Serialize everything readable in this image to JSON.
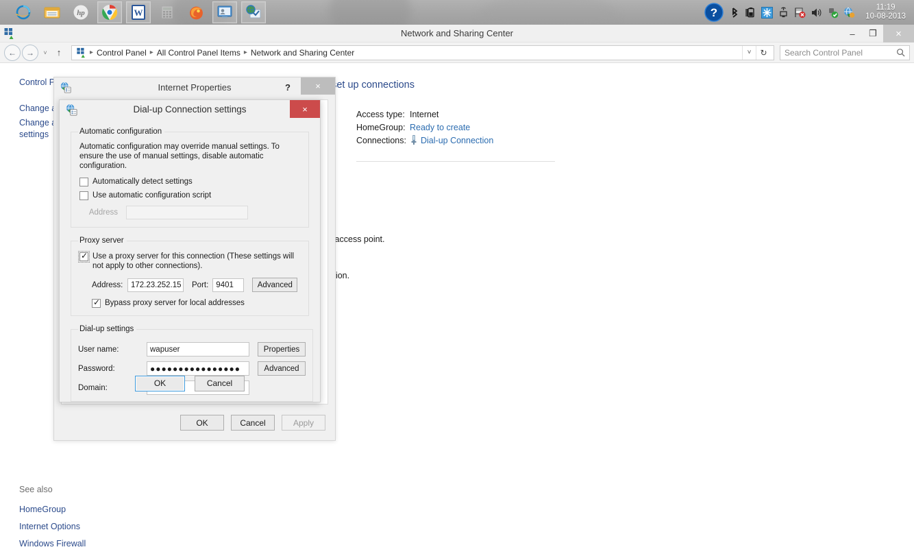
{
  "taskbar": {
    "pinned_apps": [
      {
        "name": "internet-explorer",
        "label": "Internet Explorer",
        "framed": false
      },
      {
        "name": "file-explorer",
        "label": "File Explorer",
        "framed": false
      },
      {
        "name": "hp-support",
        "label": "HP",
        "framed": false
      },
      {
        "name": "google-chrome",
        "label": "Google Chrome",
        "framed": true
      },
      {
        "name": "microsoft-word",
        "label": "Microsoft Word",
        "framed": true
      },
      {
        "name": "calculator",
        "label": "Calculator",
        "framed": false
      },
      {
        "name": "mozilla-firefox",
        "label": "Mozilla Firefox",
        "framed": false
      },
      {
        "name": "remote-desktop",
        "label": "Remote Desktop",
        "framed": true
      },
      {
        "name": "network-sharing-center",
        "label": "Network and Sharing Center",
        "framed": true
      }
    ],
    "tray_icons": [
      {
        "name": "action-center-help-icon",
        "label": "Help"
      },
      {
        "name": "bluetooth-icon",
        "label": "Bluetooth"
      },
      {
        "name": "battery-icon",
        "label": "Battery"
      },
      {
        "name": "snowflake-icon",
        "label": "Intel Graphics"
      },
      {
        "name": "network-connection-icon",
        "label": "Network"
      },
      {
        "name": "flag-error-icon",
        "label": "Action Center"
      },
      {
        "name": "volume-icon",
        "label": "Volume"
      },
      {
        "name": "safely-remove-hardware-icon",
        "label": "Safely Remove Hardware"
      },
      {
        "name": "network-globe-icon",
        "label": "Network Globe"
      }
    ],
    "clock_time": "11:19",
    "clock_date": "10-08-2013"
  },
  "explorer": {
    "title": "Network and Sharing Center",
    "window_buttons": {
      "minimize": "–",
      "maximize": "❐",
      "close": "×"
    },
    "nav": {
      "back": "←",
      "forward": "→",
      "recent": "˅",
      "up": "↑",
      "breadcrumb": [
        "Control Panel",
        "All Control Panel Items",
        "Network and Sharing Center"
      ],
      "breadcrumb_sep": "▸",
      "dropdown": "˅",
      "refresh": "↻"
    },
    "search": {
      "placeholder": "Search Control Panel",
      "icon": "search-icon"
    },
    "sidebar": {
      "items": [
        {
          "label": "Control P...",
          "name": "sidebar-control-panel-home"
        },
        {
          "label": "Change a...",
          "name": "sidebar-change-adapter-settings"
        },
        {
          "label": "Change a... settings",
          "name": "sidebar-change-advanced-sharing-settings"
        }
      ],
      "see_also_heading": "See also",
      "see_also": [
        {
          "label": "HomeGroup",
          "name": "see-also-homegroup"
        },
        {
          "label": "Internet Options",
          "name": "see-also-internet-options"
        },
        {
          "label": "Windows Firewall",
          "name": "see-also-windows-firewall"
        }
      ]
    },
    "main": {
      "heading": "View your basic network information and set up connections",
      "network_info": [
        {
          "label": "Access type:",
          "value": "Internet",
          "link": false
        },
        {
          "label": "HomeGroup:",
          "value": "Ready to create",
          "link": true
        },
        {
          "label": "Connections:",
          "value": "Dial-up Connection",
          "link": true,
          "icon": "dialup-connection-icon"
        }
      ],
      "partial_text_1": "ection; or set up a router or access point.",
      "partial_text_2": "get troubleshooting information."
    }
  },
  "internet_properties": {
    "title": "Internet Properties",
    "help_button": "?",
    "close_button": "×",
    "buttons": [
      {
        "label": "OK",
        "name": "ie-ok-button",
        "disabled": false
      },
      {
        "label": "Cancel",
        "name": "ie-cancel-button",
        "disabled": false
      },
      {
        "label": "Apply",
        "name": "ie-apply-button",
        "disabled": true
      }
    ]
  },
  "dialup_dialog": {
    "title": "Dial-up Connection settings",
    "close_button": "×",
    "auto_config": {
      "legend": "Automatic configuration",
      "description": "Automatic configuration may override manual settings.  To ensure the use of manual settings, disable automatic configuration.",
      "auto_detect": {
        "label": "Automatically detect settings",
        "checked": false
      },
      "use_script": {
        "label": "Use automatic configuration script",
        "checked": false
      },
      "address_label": "Address",
      "address_value": "",
      "address_enabled": false
    },
    "proxy": {
      "legend": "Proxy server",
      "use_proxy": {
        "label": "Use a proxy server for this connection (These settings will not apply to other connections).",
        "checked": true
      },
      "address_label": "Address:",
      "address_value": "172.23.252.15",
      "port_label": "Port:",
      "port_value": "9401",
      "advanced_label": "Advanced",
      "bypass": {
        "label": "Bypass proxy server for local addresses",
        "checked": true
      }
    },
    "dialup_settings": {
      "legend": "Dial-up settings",
      "username_label": "User name:",
      "username_value": "wapuser",
      "properties_label": "Properties",
      "password_label": "Password:",
      "password_value": "●●●●●●●●●●●●●●●●",
      "advanced_label": "Advanced",
      "domain_label": "Domain:",
      "domain_value": ""
    },
    "buttons": [
      {
        "label": "OK",
        "name": "dialup-ok-button",
        "focused": true
      },
      {
        "label": "Cancel",
        "name": "dialup-cancel-button",
        "focused": false
      }
    ]
  },
  "colors": {
    "link": "#2b4a8b",
    "accent_blue": "#2b6cb0",
    "close_red": "#cc4b4b",
    "taskbar": "#a9a9a9"
  }
}
